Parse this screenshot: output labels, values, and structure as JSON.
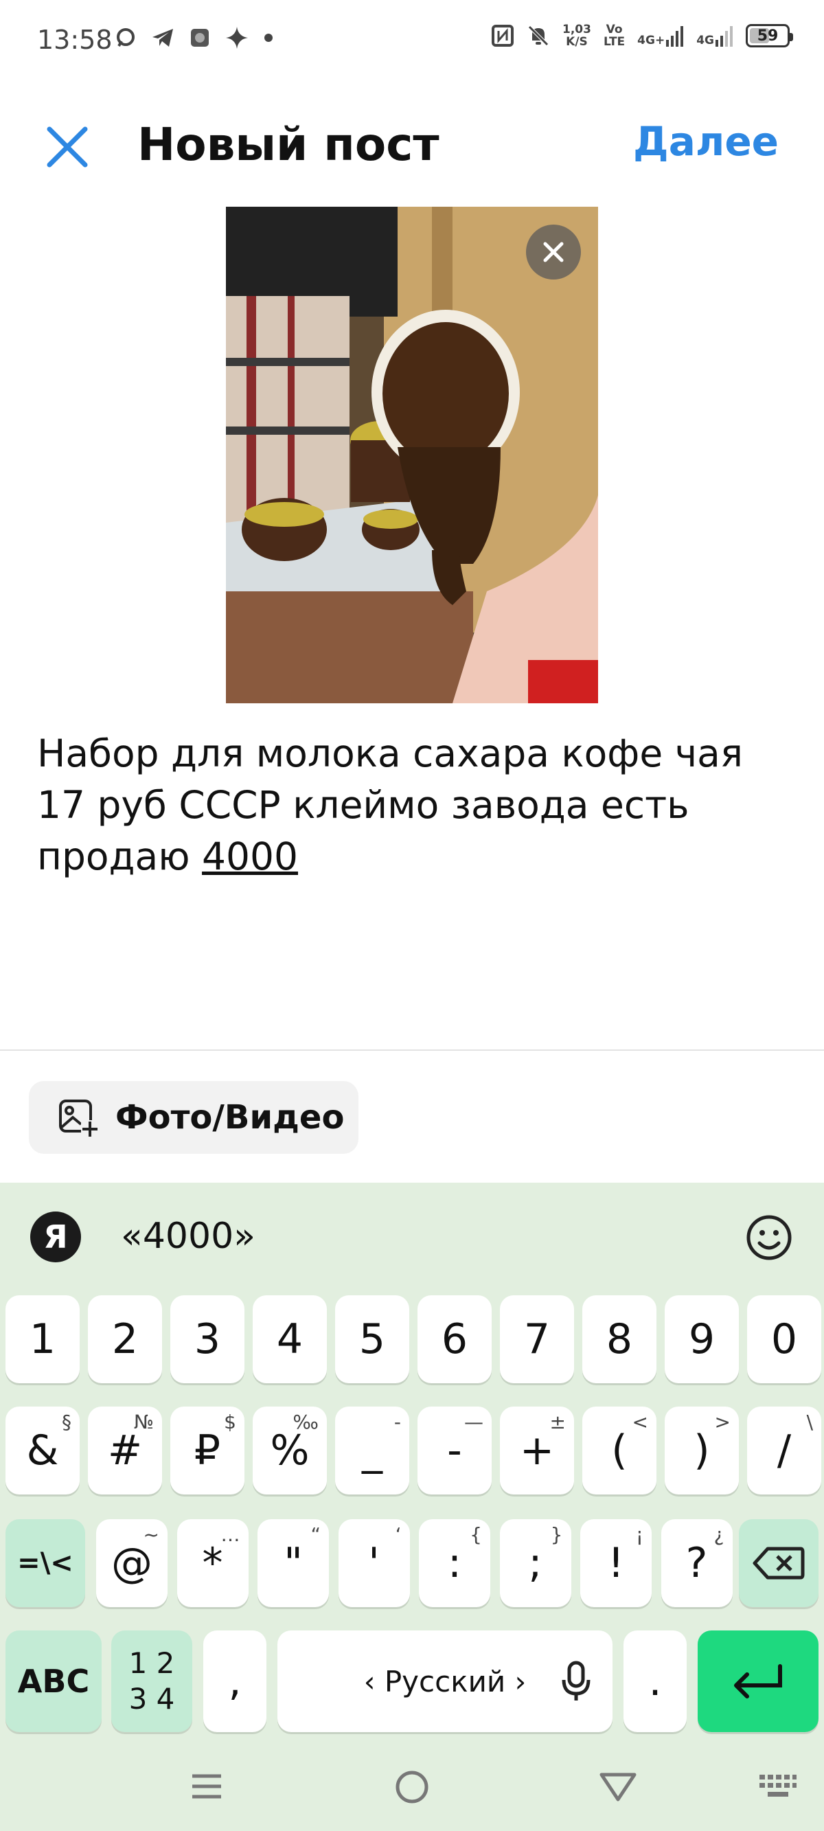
{
  "status_bar": {
    "time": "13:58",
    "net_speed_value": "1,03",
    "net_speed_unit": "K/S",
    "volte_top": "Vo",
    "volte_bottom": "LTE",
    "sim1": "4G+",
    "sim2": "4G",
    "battery": "59",
    "battery_level": 0.59
  },
  "header": {
    "title": "Новый пост",
    "next_label": "Далее"
  },
  "post": {
    "text_main": "Набор для молока сахара кофе чая 17 руб СССР клеймо завода есть продаю ",
    "text_underlined": "4000"
  },
  "media_button": {
    "label": "Фото/Видео"
  },
  "keyboard": {
    "logo": "Я",
    "suggestion": "«4000»",
    "row1": [
      "1",
      "2",
      "3",
      "4",
      "5",
      "6",
      "7",
      "8",
      "9",
      "0"
    ],
    "row2": [
      {
        "main": "&",
        "sup": "§"
      },
      {
        "main": "#",
        "sup": "№"
      },
      {
        "main": "₽",
        "sup": "$"
      },
      {
        "main": "%",
        "sup": "‰"
      },
      {
        "main": "_",
        "sup": "-"
      },
      {
        "main": "-",
        "sup": "—"
      },
      {
        "main": "+",
        "sup": "±"
      },
      {
        "main": "(",
        "sup": "<"
      },
      {
        "main": ")",
        "sup": ">"
      },
      {
        "main": "/",
        "sup": "\\"
      }
    ],
    "row3_switch": "=\\<",
    "row3": [
      {
        "main": "@",
        "sup": "~"
      },
      {
        "main": "*",
        "sup": "…"
      },
      {
        "main": "\"",
        "sup": "“"
      },
      {
        "main": "'",
        "sup": "‘"
      },
      {
        "main": ":",
        "sup": "{"
      },
      {
        "main": ";",
        "sup": "}"
      },
      {
        "main": "!",
        "sup": "¡"
      },
      {
        "main": "?",
        "sup": "¿"
      }
    ],
    "abc": "ABC",
    "num_top": "1 2",
    "num_bottom": "3 4",
    "comma": ",",
    "space_label": "‹ Русский ›",
    "period": "."
  },
  "colors": {
    "accent": "#2d87e2",
    "keyboard_bg": "#e2efdf",
    "enter_key": "#1ed97f",
    "function_key": "#c3ebd5"
  }
}
